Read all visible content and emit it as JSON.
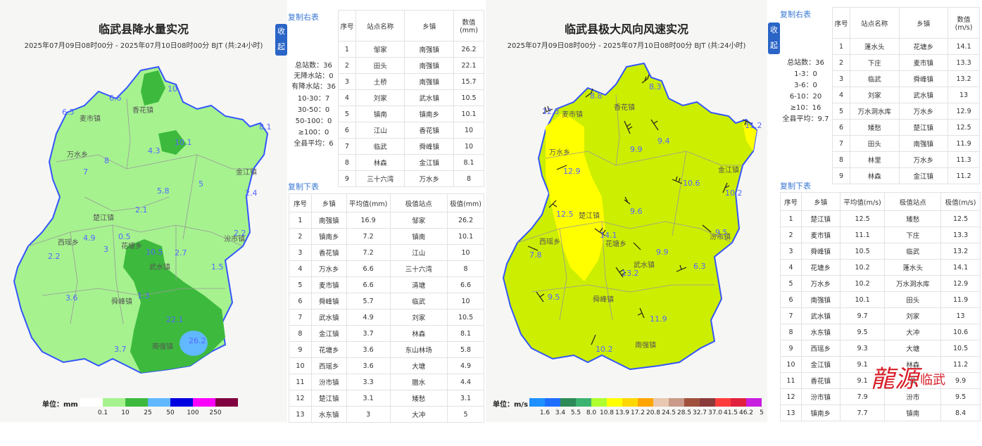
{
  "left": {
    "title": "临武县降水量实况",
    "subtitle": "2025年07月09日08时00分 - 2025年07月10日08时00分 BJT (共:24小时)",
    "collapse": [
      "收",
      "起"
    ],
    "copy_right": "复制右表",
    "copy_below": "复制下表",
    "stats": [
      "总站数：36",
      "无降水站：0",
      "有降水站：36",
      "10-30：7",
      "30-50：0",
      "50-100：0",
      "≥100：0",
      "全县平均：6"
    ],
    "legend_unit": "单位：mm",
    "legend_ticks": [
      "0.1",
      "10",
      "25",
      "50",
      "100",
      "250"
    ],
    "legend_colors": [
      "#ffffff",
      "#a6f28f",
      "#3dba3d",
      "#61b8ff",
      "#0000e1",
      "#fa00fa",
      "#800040"
    ],
    "table1_headers": [
      "序号",
      "站点名称",
      "乡镇",
      "数值",
      "(mm)"
    ],
    "table1": [
      [
        "1",
        "邹家",
        "南强镇",
        "26.2"
      ],
      [
        "2",
        "田头",
        "南强镇",
        "22.1"
      ],
      [
        "3",
        "土桥",
        "南强镇",
        "15.7"
      ],
      [
        "4",
        "刘家",
        "武水镇",
        "10.5"
      ],
      [
        "5",
        "镇南",
        "镇南乡",
        "10.1"
      ],
      [
        "6",
        "江山",
        "香花镇",
        "10"
      ],
      [
        "7",
        "临武",
        "舜峰镇",
        "10"
      ],
      [
        "8",
        "林森",
        "金江镇",
        "8.1"
      ],
      [
        "9",
        "三十六湾",
        "万水乡",
        "8"
      ]
    ],
    "table2_headers": [
      "序号",
      "乡镇",
      "平均值(mm)",
      "极值站点",
      "极值(mm)"
    ],
    "table2": [
      [
        "1",
        "南强镇",
        "16.9",
        "邹家",
        "26.2"
      ],
      [
        "2",
        "镇南乡",
        "7.2",
        "镇南",
        "10.1"
      ],
      [
        "3",
        "香花镇",
        "7.2",
        "江山",
        "10"
      ],
      [
        "4",
        "万水乡",
        "6.6",
        "三十六湾",
        "8"
      ],
      [
        "5",
        "麦市镇",
        "6.6",
        "清塘",
        "6.6"
      ],
      [
        "6",
        "舜峰镇",
        "5.7",
        "临武",
        "10"
      ],
      [
        "7",
        "武水镇",
        "4.9",
        "刘家",
        "10.5"
      ],
      [
        "8",
        "金江镇",
        "3.7",
        "林森",
        "8.1"
      ],
      [
        "9",
        "花塘乡",
        "3.6",
        "东山林场",
        "5.8"
      ],
      [
        "10",
        "西瑶乡",
        "3.6",
        "大塘",
        "4.9"
      ],
      [
        "11",
        "汾市镇",
        "3.3",
        "腊水",
        "4.4"
      ],
      [
        "12",
        "楚江镇",
        "3.1",
        "矮愁",
        "3.1"
      ],
      [
        "13",
        "水东镇",
        "3",
        "大冲",
        "5"
      ]
    ],
    "map_labels": [
      "香花镇",
      "麦市镇",
      "万水乡",
      "金江镇",
      "楚江镇",
      "西瑶乡",
      "花塘乡",
      "武水镇",
      "汾市镇",
      "舜峰镇",
      "南强镇"
    ],
    "map_values": [
      "6.6",
      "6.5",
      "10",
      "10.1",
      "4.3",
      "8.1",
      "7",
      "8",
      "5.8",
      "5",
      "2.4",
      "2.1",
      "4.9",
      "0.5",
      "3",
      "10.5",
      "2.7",
      "2.2",
      "2.2",
      "1.5",
      "3.6",
      "1.3",
      "22.1",
      "26.2",
      "3.7"
    ]
  },
  "right": {
    "title": "临武县极大风向风速实况",
    "subtitle": "2025年07月09日08时00分 - 2025年07月10日08时00分 BJT (共:24小时)",
    "collapse": [
      "收",
      "起"
    ],
    "copy_right": "复制右表",
    "copy_below": "复制下表",
    "stats": [
      "总站数：36",
      "1-3：0",
      "3-6：0",
      "6-10：20",
      "≥10：16",
      "全县平均：9.7"
    ],
    "legend_unit": "单位：m/s",
    "legend_ticks": [
      "1.6",
      "3.4",
      "5.5",
      "8.0",
      "10.8",
      "13.9",
      "17.2",
      "20.8",
      "24.5",
      "28.5",
      "32.7",
      "37.0",
      "41.5",
      "46.2",
      "5"
    ],
    "legend_colors": [
      "#1e90ff",
      "#1e6eff",
      "#2e8b57",
      "#3cb371",
      "#adff2f",
      "#ffff00",
      "#ffd700",
      "#ffa500",
      "#e8c8b0",
      "#c99a8a",
      "#a0523d",
      "#8b3a3a",
      "#ff3c3c",
      "#e0203c",
      "#c81ee0"
    ],
    "table1_headers": [
      "序号",
      "站点名称",
      "乡镇",
      "数值",
      "(m/s)"
    ],
    "table1": [
      [
        "1",
        "蓬水头",
        "花塘乡",
        "14.1"
      ],
      [
        "2",
        "下庄",
        "麦市镇",
        "13.3"
      ],
      [
        "3",
        "临武",
        "舜峰镇",
        "13.2"
      ],
      [
        "4",
        "刘家",
        "武水镇",
        "13"
      ],
      [
        "5",
        "万水洞水库",
        "万水乡",
        "12.9"
      ],
      [
        "6",
        "矮愁",
        "楚江镇",
        "12.5"
      ],
      [
        "7",
        "田头",
        "南强镇",
        "11.9"
      ],
      [
        "8",
        "林里",
        "万水乡",
        "11.3"
      ],
      [
        "9",
        "林森",
        "金江镇",
        "11.2"
      ]
    ],
    "table2_headers": [
      "序号",
      "乡镇",
      "平均值(m/s)",
      "极值站点",
      "极值(m/s)"
    ],
    "table2": [
      [
        "1",
        "楚江镇",
        "12.5",
        "矮愁",
        "12.5"
      ],
      [
        "2",
        "麦市镇",
        "11.1",
        "下庄",
        "13.3"
      ],
      [
        "3",
        "舜峰镇",
        "10.5",
        "临武",
        "13.2"
      ],
      [
        "4",
        "花塘乡",
        "10.2",
        "蓬水头",
        "14.1"
      ],
      [
        "5",
        "万水乡",
        "10.2",
        "万水洞水库",
        "12.9"
      ],
      [
        "6",
        "南强镇",
        "10.1",
        "田头",
        "11.9"
      ],
      [
        "7",
        "武水镇",
        "9.7",
        "刘家",
        "13"
      ],
      [
        "8",
        "水东镇",
        "9.5",
        "大冲",
        "10.6"
      ],
      [
        "9",
        "西瑶乡",
        "9.3",
        "大塘",
        "10.5"
      ],
      [
        "10",
        "金江镇",
        "9.1",
        "林森",
        "11.2"
      ],
      [
        "11",
        "香花镇",
        "9.1",
        "黄",
        "9.9"
      ],
      [
        "12",
        "汾市镇",
        "7.9",
        "汾市",
        "9.5"
      ],
      [
        "13",
        "镇南乡",
        "7.7",
        "镇南",
        "8.4"
      ]
    ],
    "map_labels": [
      "香花镇",
      "麦市镇",
      "万水乡",
      "金江镇",
      "楚江镇",
      "西瑶乡",
      "花塘乡",
      "武水镇",
      "汾市镇",
      "舜峰镇",
      "南强镇"
    ],
    "map_values": [
      "8.8",
      "8.3",
      "12.3",
      "9.9",
      "9.4",
      "11.2",
      "12.9",
      "10.6",
      "10.2",
      "12.5",
      "9.6",
      "14.1",
      "9.5",
      "7.8",
      "9.9",
      "13.2",
      "6.3",
      "9.5",
      "11.9",
      "10.2"
    ]
  },
  "logo_text": "临武"
}
